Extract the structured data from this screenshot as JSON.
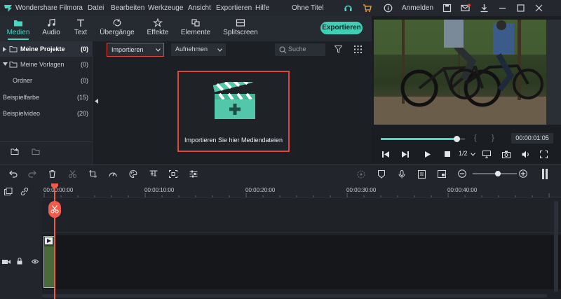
{
  "app": {
    "title": "Wondershare Filmora",
    "project_title": "Ohne Titel"
  },
  "menu": [
    "Datei",
    "Bearbeiten",
    "Werkzeuge",
    "Ansicht",
    "Exportieren",
    "Hilfe"
  ],
  "account": {
    "login": "Anmelden"
  },
  "tabs": [
    "Medien",
    "Audio",
    "Text",
    "Übergänge",
    "Effekte",
    "Elemente",
    "Splitscreen"
  ],
  "export_label": "Exportieren",
  "sidebar": {
    "items": [
      {
        "label": "Meine Projekte",
        "count": "(0)"
      },
      {
        "label": "Meine Vorlagen",
        "count": "(0)"
      },
      {
        "label": "Ordner",
        "count": "(0)"
      },
      {
        "label": "Beispielfarbe",
        "count": "(15)"
      },
      {
        "label": "Beispielvideo",
        "count": "(20)"
      }
    ]
  },
  "media": {
    "import_label": "Importieren",
    "record_label": "Aufnehmen",
    "search_placeholder": "Suche",
    "drop_label": "Importieren Sie hier Mediendateien"
  },
  "preview": {
    "timecode": "00:00:01:05",
    "quality": "1/2",
    "progress": 0.9
  },
  "timeline": {
    "ruler": [
      "00:00:00:00",
      "00:00:10:00",
      "00:00:20:00",
      "00:00:30:00",
      "00:00:40:00"
    ]
  },
  "colors": {
    "accent": "#49d6c2",
    "highlight": "#e0453a",
    "playhead": "#f25a4a"
  }
}
